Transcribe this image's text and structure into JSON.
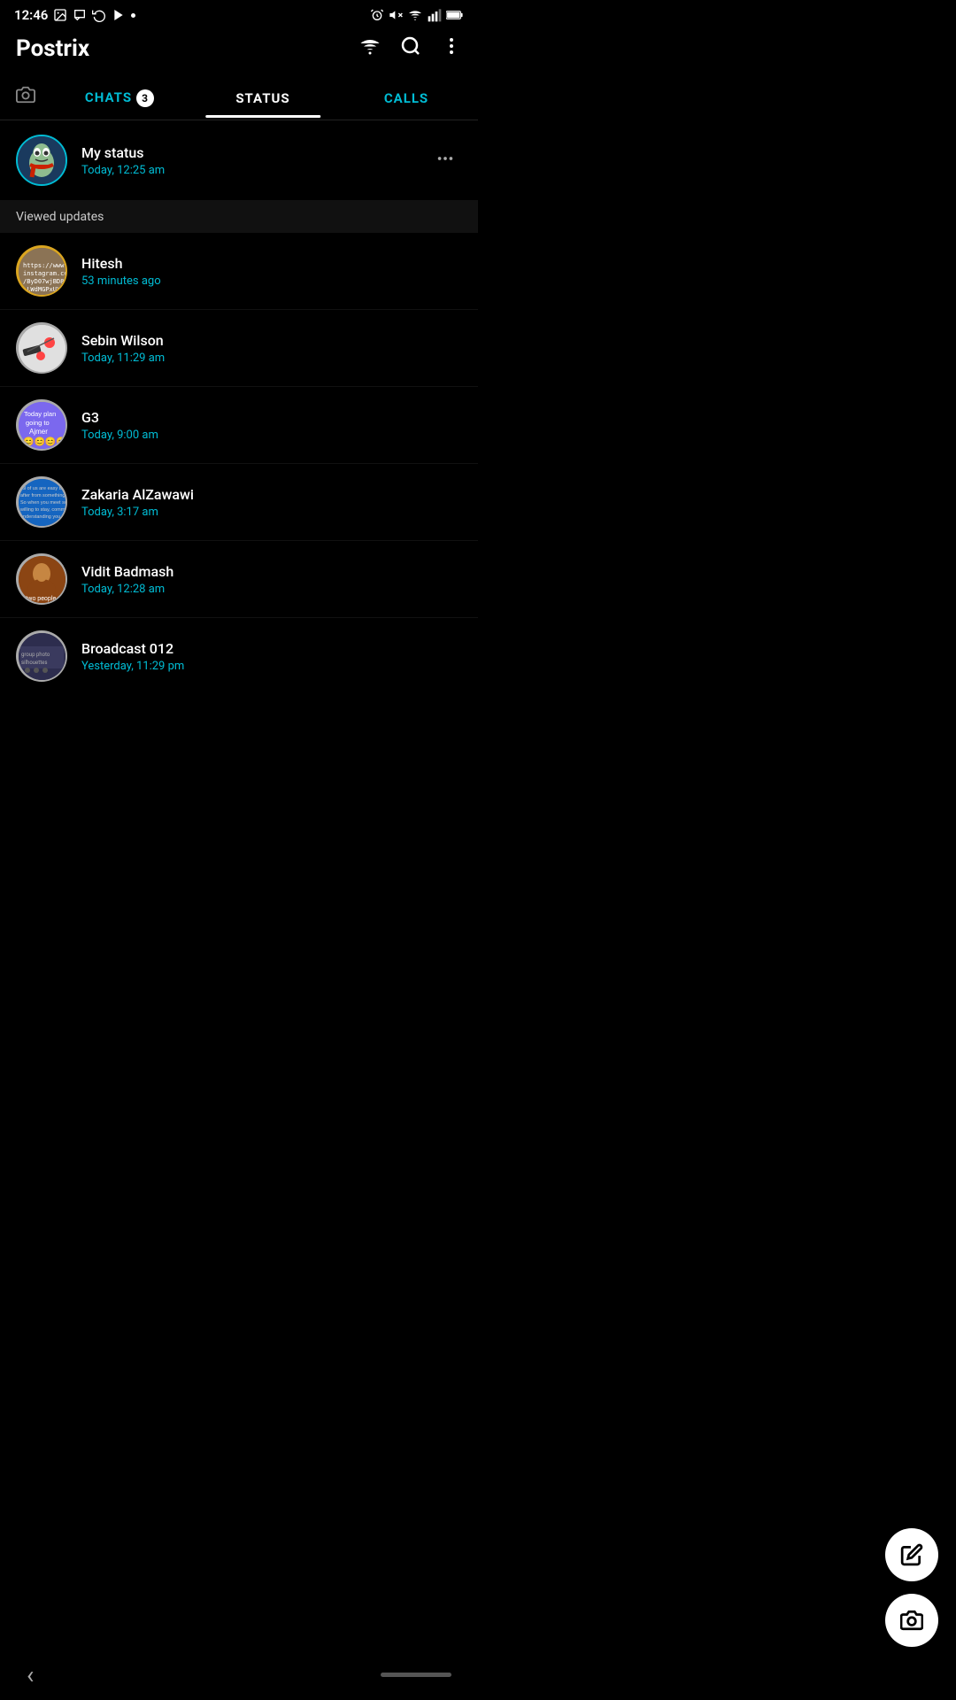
{
  "statusBar": {
    "time": "12:46",
    "icons": [
      "image",
      "message",
      "sync",
      "play",
      "dot"
    ]
  },
  "appBar": {
    "title": "Postrix",
    "searchLabel": "search",
    "moreLabel": "more options"
  },
  "tabs": {
    "camera": "camera",
    "chats": {
      "label": "CHATS",
      "badge": "3"
    },
    "status": {
      "label": "STATUS"
    },
    "calls": {
      "label": "CALLS"
    }
  },
  "myStatus": {
    "name": "My status",
    "time": "Today, 12:25 am"
  },
  "viewedUpdates": {
    "header": "Viewed updates",
    "items": [
      {
        "name": "Hitesh",
        "time": "53 minutes ago",
        "avatarClass": "avatar-hitesh"
      },
      {
        "name": "Sebin Wilson",
        "time": "Today, 11:29 am",
        "avatarClass": "avatar-sebin"
      },
      {
        "name": "G3",
        "time": "Today, 9:00 am",
        "avatarClass": "avatar-g3"
      },
      {
        "name": "Zakaria AlZawawi",
        "time": "Today, 3:17 am",
        "avatarClass": "avatar-zakaria"
      },
      {
        "name": "Vidit Badmash",
        "time": "Today, 12:28 am",
        "avatarClass": "avatar-vidit"
      },
      {
        "name": "Broadcast 012",
        "time": "Yesterday, 11:29 pm",
        "avatarClass": "avatar-broadcast"
      }
    ]
  },
  "fabs": {
    "pencil": "✏",
    "camera": "⊙"
  },
  "bottomNav": {
    "back": "‹"
  }
}
